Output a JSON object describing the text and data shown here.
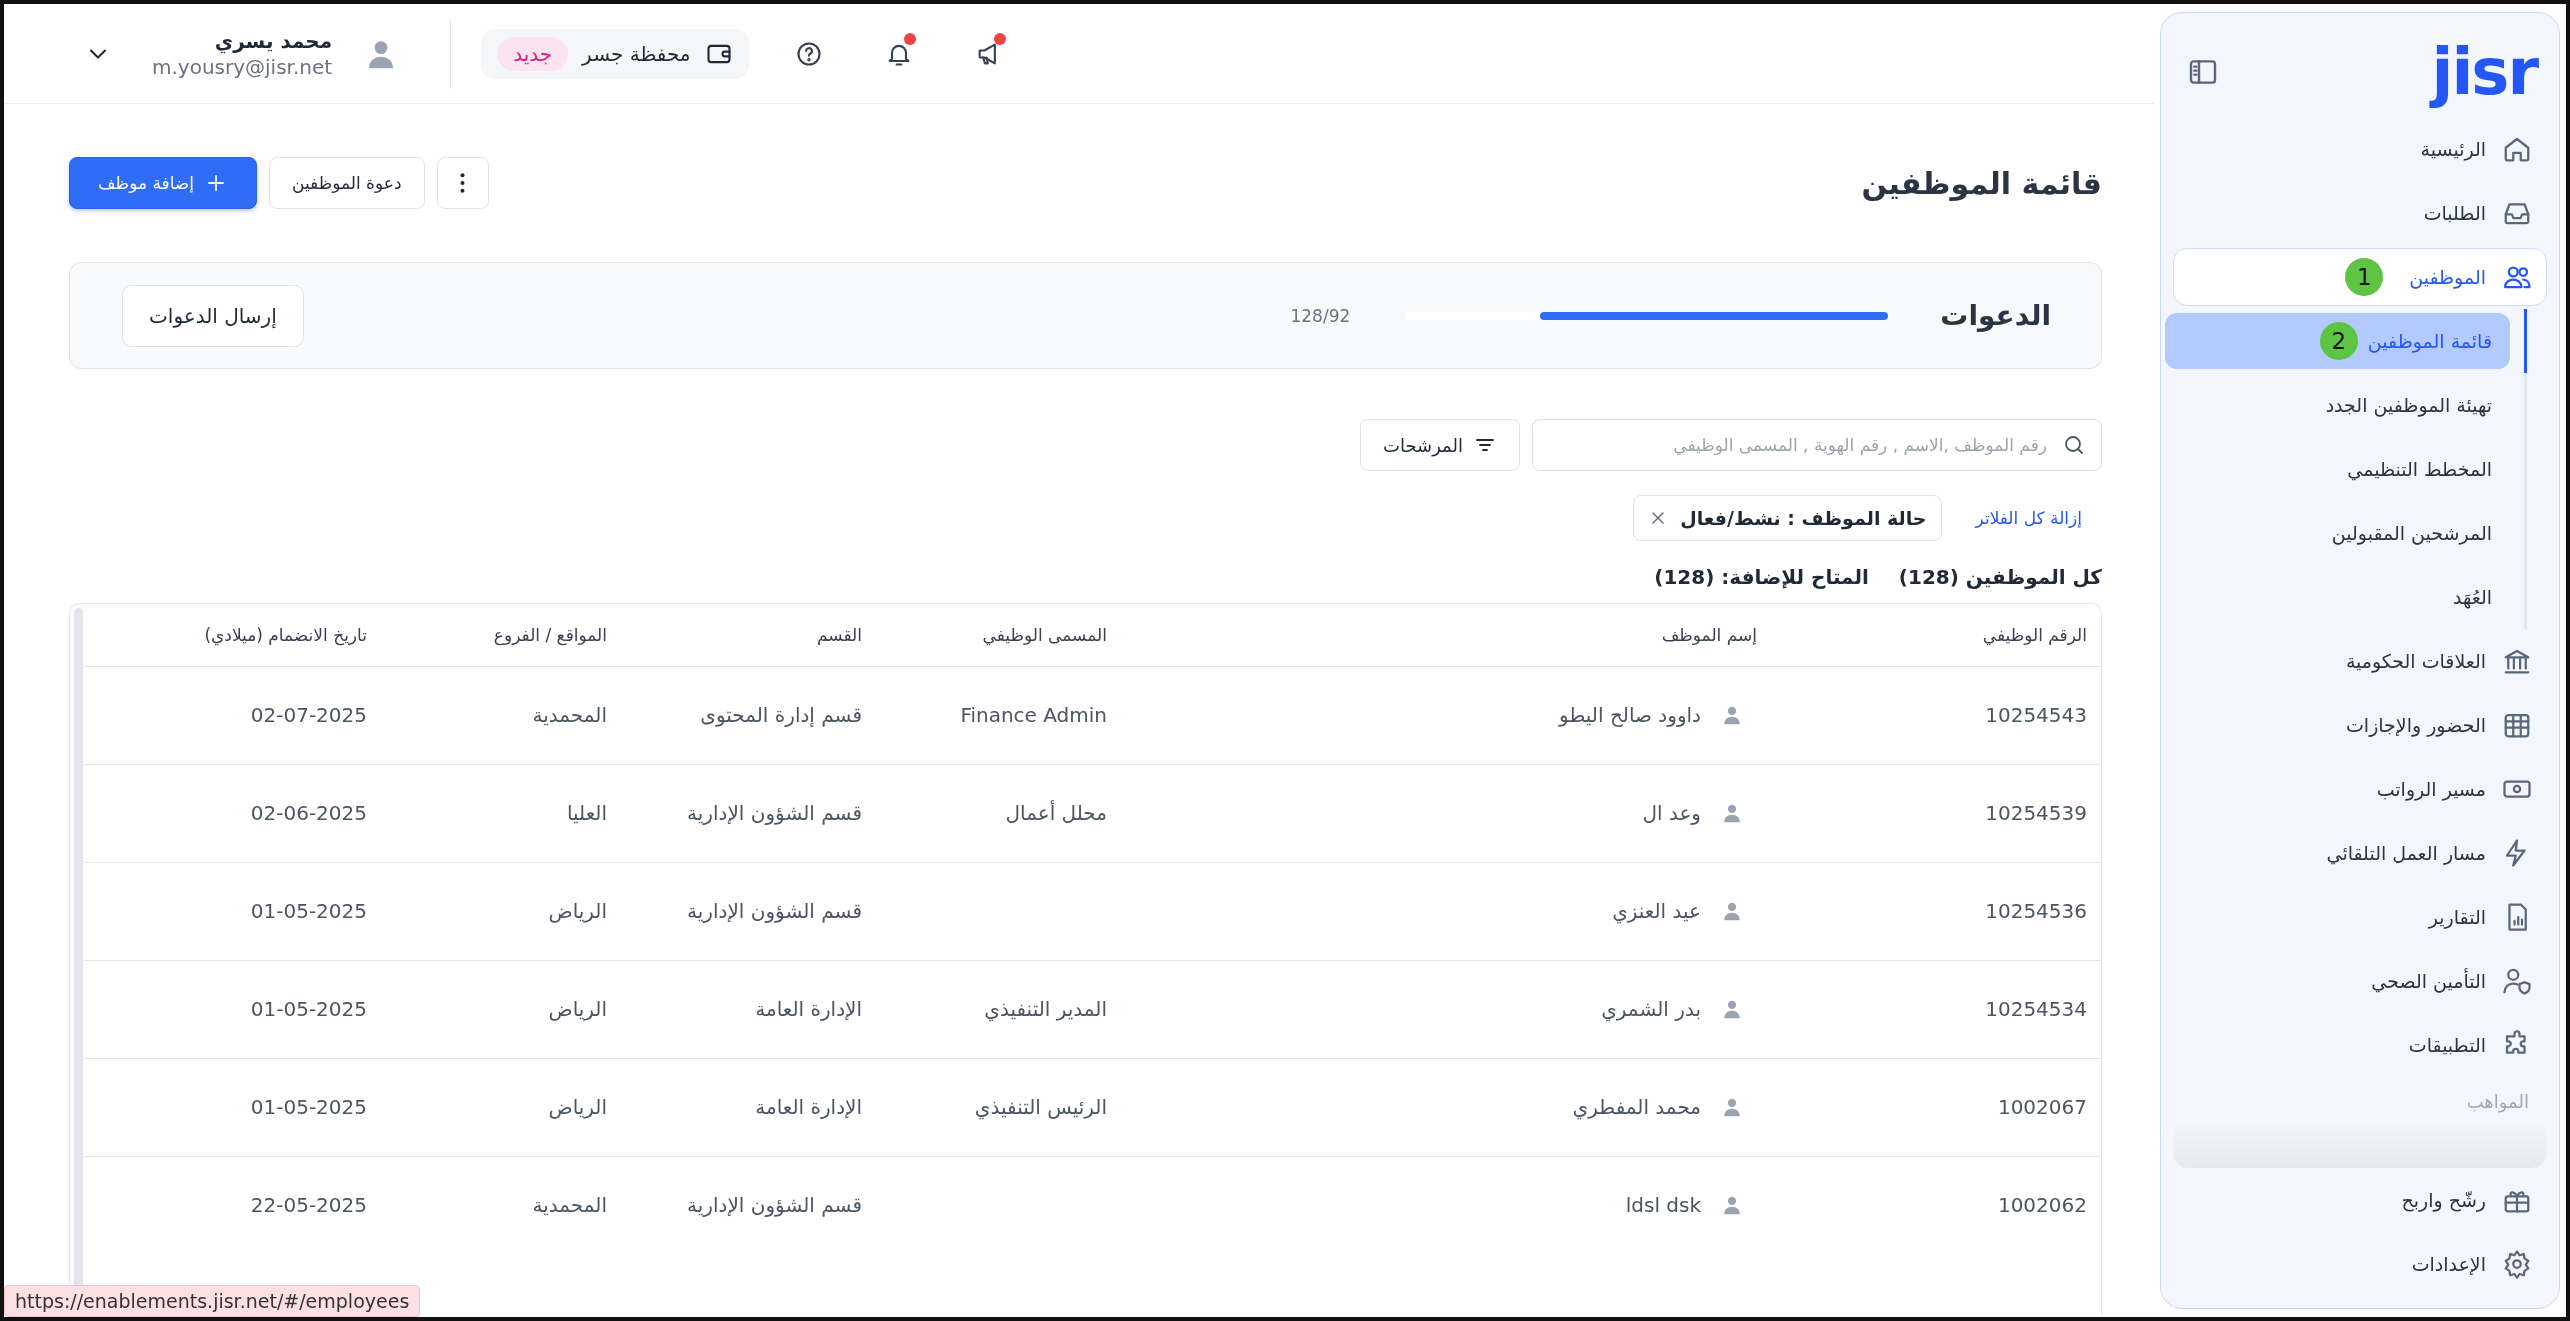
{
  "sidebar": {
    "logo": "jisr",
    "items": [
      {
        "label": "الرئيسية",
        "selected": false
      },
      {
        "label": "الطلبات",
        "selected": false
      },
      {
        "label": "الموظفين",
        "selected": true,
        "expanded": true,
        "badge": "1",
        "children": [
          {
            "label": "قائمة الموظفين",
            "selected": true,
            "badge": "2"
          },
          {
            "label": "تهيئة الموظفين الجدد",
            "selected": false
          },
          {
            "label": "المخطط التنظيمي",
            "selected": false
          },
          {
            "label": "المرشحين المقبولين",
            "selected": false
          },
          {
            "label": "العُهَد",
            "selected": false
          }
        ]
      },
      {
        "label": "العلاقات الحكومية",
        "selected": false
      },
      {
        "label": "الحضور والإجازات",
        "selected": false
      },
      {
        "label": "مسير الرواتب",
        "selected": false
      },
      {
        "label": "مسار العمل التلقائي",
        "selected": false
      },
      {
        "label": "التقارير",
        "selected": false
      },
      {
        "label": "التأمين الصحي",
        "selected": false
      },
      {
        "label": "التطبيقات",
        "selected": false
      }
    ],
    "section_label": "المواهب",
    "bottom_items": [
      {
        "label": "رشّح واربح",
        "selected": false
      },
      {
        "label": "الإعدادات",
        "selected": false
      }
    ]
  },
  "topbar": {
    "icons": [
      {
        "alert": true
      },
      {
        "alert": true
      },
      {
        "alert": false
      }
    ],
    "wallet": {
      "label": "محفظة جسر",
      "badge": "جديد"
    },
    "user": {
      "name": "محمد يسري",
      "email": "m.yousry@jisr.net"
    }
  },
  "page": {
    "title": "قائمة الموظفين",
    "buttons": [
      {
        "kind": "more"
      },
      {
        "kind": "secondary",
        "label": "دعوة الموظفين"
      },
      {
        "kind": "primary",
        "label": "إضافة موظف"
      }
    ]
  },
  "invitations": {
    "title": "الدعوات",
    "level": 0.72,
    "reading": "128/92",
    "button": "إرسال الدعوات"
  },
  "search": {
    "placeholder": "رقم الموظف ,الاسم , رقم الهوية , المسمى الوظيفي"
  },
  "filters_button": "المرشحات",
  "clear_filters": "إزالة كل الفلاتر",
  "chips": [
    {
      "label": "حالة الموظف : نشط/فعال"
    }
  ],
  "counts": [
    "كل الموظفين (128)",
    "المتاح للإضافة: (128)"
  ],
  "table": {
    "columns": [
      "الرقم الوظيفي",
      "إسم الموظف",
      "المسمى الوظيفي",
      "القسم",
      "المواقع / الفروع",
      "تاريخ الانضمام (ميلادي)"
    ],
    "rows": [
      {
        "id": "10254543",
        "name": "داوود صالح اليطو",
        "title": "Finance Admin",
        "department": "قسم إدارة المحتوى",
        "location": "المحمدية",
        "joined": "02-07-2025"
      },
      {
        "id": "10254539",
        "name": "وعد ال",
        "title": "محلل أعمال",
        "department": "قسم الشؤون الإدارية",
        "location": "العليا",
        "joined": "02-06-2025"
      },
      {
        "id": "10254536",
        "name": "عيد العنزي",
        "department": "قسم الشؤون الإدارية",
        "location": "الرياض",
        "joined": "01-05-2025"
      },
      {
        "id": "10254534",
        "name": "بدر الشمري",
        "title": "المدير التنفيذي",
        "department": "الإدارة العامة",
        "location": "الرياض",
        "joined": "01-05-2025"
      },
      {
        "id": "1002067",
        "name": "محمد المفطري",
        "title": "الرئيس التنفيذي",
        "department": "الإدارة العامة",
        "location": "الرياض",
        "joined": "01-05-2025"
      },
      {
        "id": "1002062",
        "name": "ldsl dsk",
        "department": "قسم الشؤون الإدارية",
        "location": "المحمدية",
        "joined": "22-05-2025"
      }
    ]
  },
  "status_bar": {
    "url": "https://enablements.jisr.net/#/employees"
  }
}
